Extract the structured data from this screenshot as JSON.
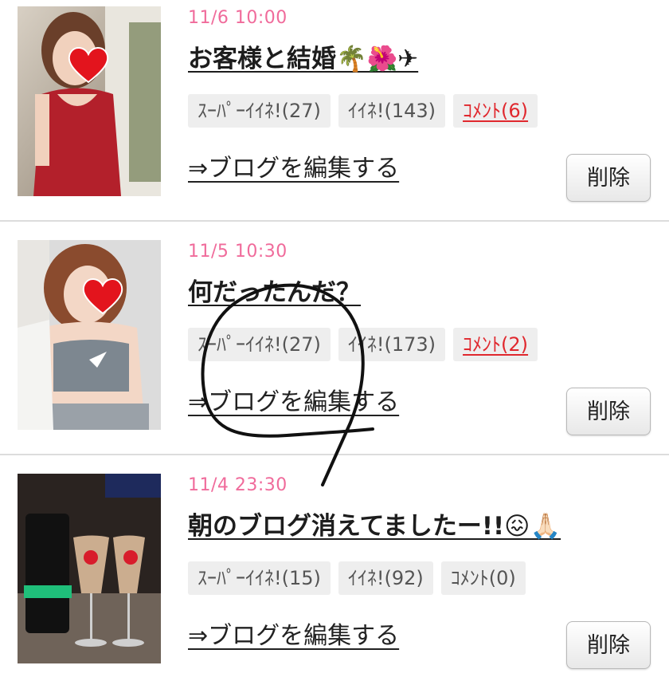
{
  "posts": [
    {
      "date": "11/6 10:00",
      "title": "お客様と結婚🌴🌺✈",
      "super_like": "ｽｰﾊﾟｰｲｲﾈ!(27)",
      "like": "ｲｲﾈ!(143)",
      "comment": "ｺﾒﾝﾄ(6)",
      "edit": "⇒ブログを編集する",
      "delete": "削除"
    },
    {
      "date": "11/5 10:30",
      "title": "何だったんだ？",
      "super_like": "ｽｰﾊﾟｰｲｲﾈ!(27)",
      "like": "ｲｲﾈ!(173)",
      "comment": "ｺﾒﾝﾄ(2)",
      "edit": "⇒ブログを編集する",
      "delete": "削除"
    },
    {
      "date": "11/4 23:30",
      "title": "朝のブログ消えてましたー!!😖🙏🏻",
      "super_like": "ｽｰﾊﾟｰｲｲﾈ!(15)",
      "like": "ｲｲﾈ!(92)",
      "comment": "ｺﾒﾝﾄ(0)",
      "edit": "⇒ブログを編集する",
      "delete": "削除"
    }
  ],
  "colors": {
    "date": "#f06b9b",
    "comment_active": "#e0282e",
    "chip_bg": "#eeeeee",
    "scribble": "#111111"
  },
  "icons": [
    "heart-sticker-icon",
    "palm-tree-emoji",
    "hibiscus-emoji",
    "airplane-emoji",
    "confounded-face-emoji",
    "folded-hands-emoji"
  ]
}
